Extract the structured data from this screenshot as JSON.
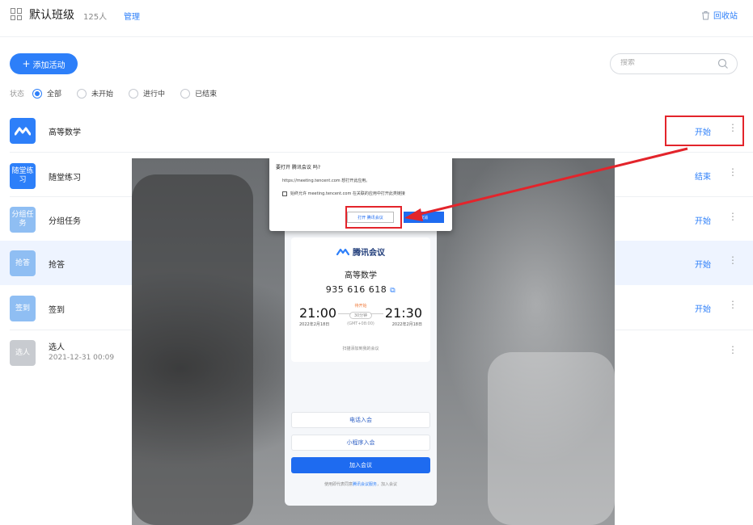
{
  "header": {
    "class_title": "默认班级",
    "member_count": "125人",
    "manage_label": "管理",
    "recycle_label": "回收站"
  },
  "toolbar": {
    "add_label": "添加活动",
    "search_placeholder": "搜索"
  },
  "filter": {
    "label": "状态",
    "options": [
      "全部",
      "未开始",
      "进行中",
      "已结束"
    ],
    "selected": "全部"
  },
  "activities": [
    {
      "icon_text": "",
      "icon_name": "tencent-meeting-icon",
      "icon_color": "#2d7ff9",
      "name": "高等数学",
      "sub": "",
      "action": "开始"
    },
    {
      "icon_text": "随堂练习",
      "icon_name": "practice-icon",
      "icon_color": "#2d7ff9",
      "name": "随堂练习",
      "sub": "",
      "action": "结束"
    },
    {
      "icon_text": "分组任务",
      "icon_name": "group-task-icon",
      "icon_color": "#8fbef3",
      "name": "分组任务",
      "sub": "",
      "action": "开始"
    },
    {
      "icon_text": "抢答",
      "icon_name": "quick-answer-icon",
      "icon_color": "#8fbef3",
      "name": "抢答",
      "sub": "",
      "action": "开始"
    },
    {
      "icon_text": "签到",
      "icon_name": "check-in-icon",
      "icon_color": "#8fbef3",
      "name": "签到",
      "sub": "",
      "action": "开始"
    },
    {
      "icon_text": "选人",
      "icon_name": "pick-person-icon",
      "icon_color": "#c8cbd0",
      "name": "选人",
      "sub": "2021-12-31 00:09",
      "action": ""
    }
  ],
  "meeting": {
    "brand": "腾讯会议",
    "title": "高等数学",
    "meeting_id": "935 616 618",
    "start_time": "21:00",
    "end_time": "21:30",
    "start_date": "2022年2月18日",
    "end_date": "2022年2月18日",
    "status": "待开始",
    "duration": "30分钟",
    "timezone": "(GMT+08:00)",
    "qr_hint": "扫描添加到我的会议",
    "phone_join": "电话入会",
    "mini_program_join": "小程序入会",
    "join_button": "加入会议",
    "footer_prefix": "使用即代表同意",
    "footer_link": "腾讯会议服务",
    "footer_suffix": "，加入会议",
    "dialog": {
      "question": "要打开 腾讯会议 吗?",
      "url_text": "https://meeting.tencent.com 想打开此应用。",
      "checkbox_text": "始终允许 meeting.tencent.com 在关联的应用中打开此类链接",
      "open_button": "打开 腾讯会议",
      "cancel_button": "取消"
    }
  },
  "colors": {
    "accent": "#2d7ff9",
    "highlight": "#e3242b"
  }
}
